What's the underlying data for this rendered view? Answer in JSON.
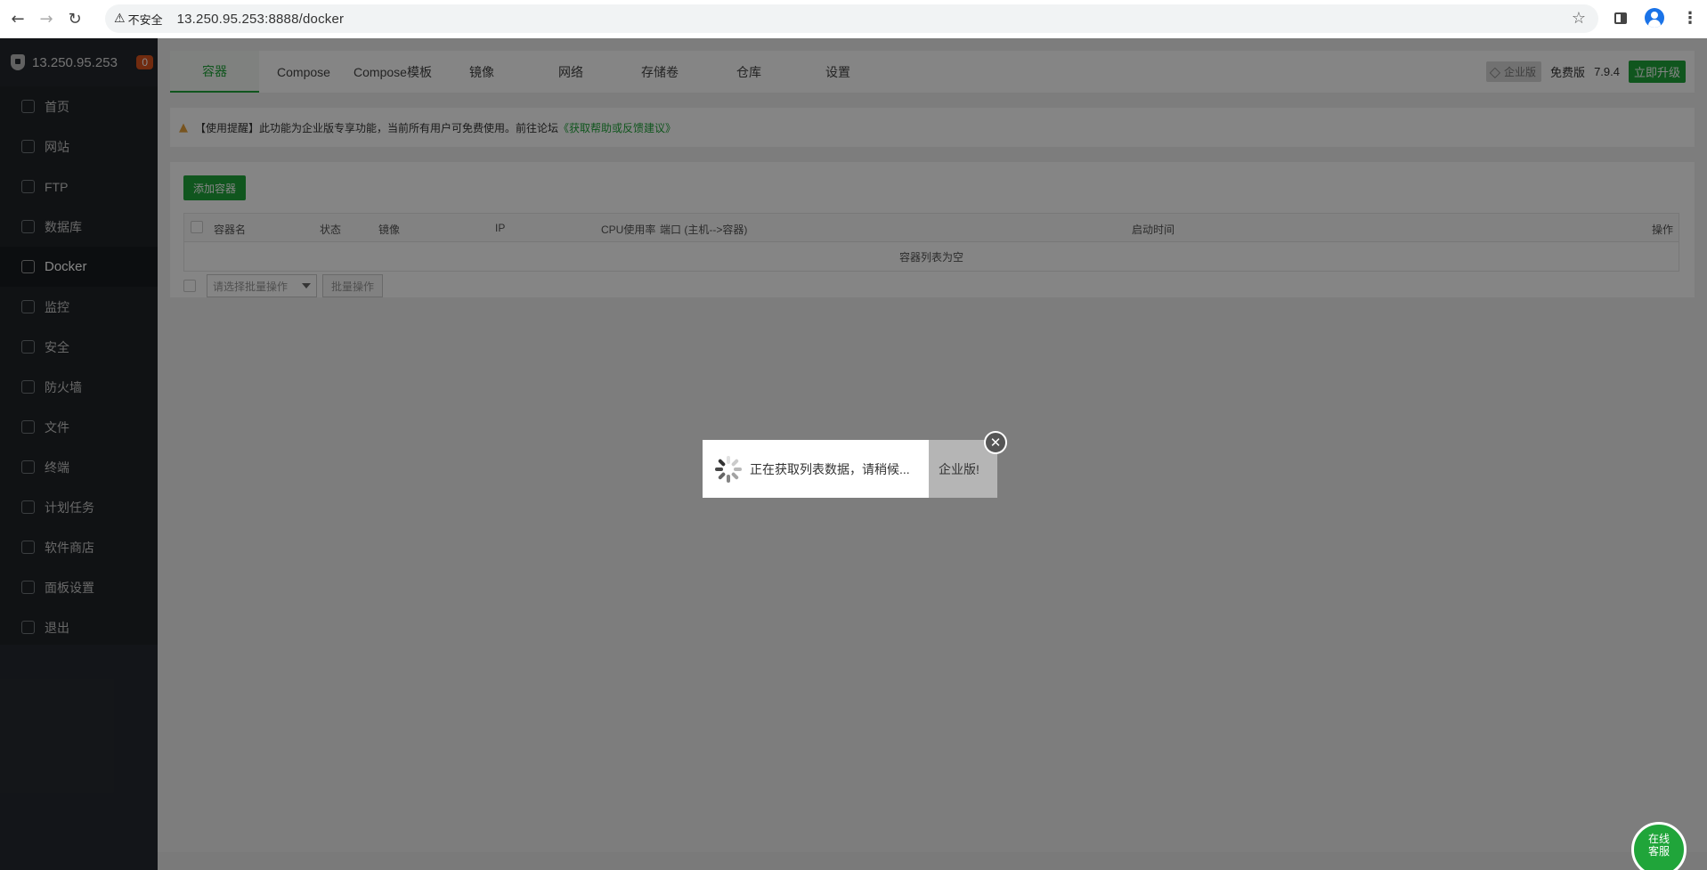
{
  "browser": {
    "security_label": "不安全",
    "url": "13.250.95.253:8888/docker"
  },
  "sidebar": {
    "host": "13.250.95.253",
    "badge": "0",
    "items": [
      {
        "label": "首页",
        "icon": "home-icon"
      },
      {
        "label": "网站",
        "icon": "globe-icon"
      },
      {
        "label": "FTP",
        "icon": "ftp-icon"
      },
      {
        "label": "数据库",
        "icon": "database-icon"
      },
      {
        "label": "Docker",
        "icon": "docker-icon",
        "active": true
      },
      {
        "label": "监控",
        "icon": "monitor-icon"
      },
      {
        "label": "安全",
        "icon": "shield-icon"
      },
      {
        "label": "防火墙",
        "icon": "firewall-icon"
      },
      {
        "label": "文件",
        "icon": "folder-icon"
      },
      {
        "label": "终端",
        "icon": "terminal-icon"
      },
      {
        "label": "计划任务",
        "icon": "calendar-icon"
      },
      {
        "label": "软件商店",
        "icon": "apps-icon"
      },
      {
        "label": "面板设置",
        "icon": "gear-icon"
      },
      {
        "label": "退出",
        "icon": "logout-icon"
      }
    ]
  },
  "tabs": [
    "容器",
    "Compose",
    "Compose模板",
    "镜像",
    "网络",
    "存储卷",
    "仓库",
    "设置"
  ],
  "topbar": {
    "enterprise_label": "企业版",
    "free_label": "免费版",
    "version": "7.9.4",
    "upgrade_label": "立即升级"
  },
  "notice": {
    "text": "【使用提醒】此功能为企业版专享功能，当前所有用户可免费使用。前往论坛",
    "link": "《获取帮助或反馈建议》"
  },
  "panel": {
    "add_button": "添加容器",
    "columns": [
      "容器名",
      "状态",
      "镜像",
      "IP",
      "CPU使用率",
      "端口 (主机-->容器)",
      "启动时间",
      "操作"
    ],
    "empty_text": "容器列表为空",
    "batch_placeholder": "请选择批量操作",
    "batch_button": "批量操作"
  },
  "modal": {
    "loading_text": "正在获取列表数据，请稍候...",
    "back_text": "企业版!"
  },
  "chat": {
    "label": "在线客服"
  },
  "colors": {
    "accent": "#20a53a",
    "sidebar_bg": "#1f2328",
    "badge": "#d9531e"
  }
}
